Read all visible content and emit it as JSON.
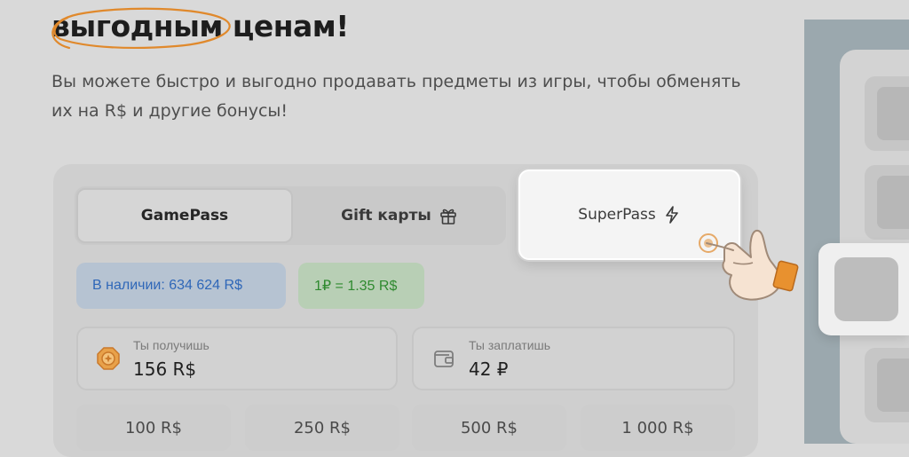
{
  "headline": {
    "highlight": "выгодным",
    "rest": " ценам!"
  },
  "subtitle": "Вы можете быстро и выгодно продавать предметы из игры, чтобы обменять их на R$ и другие бонусы!",
  "tabs": [
    {
      "label": "GamePass"
    },
    {
      "label": "Gift карты",
      "icon": "gift-icon"
    },
    {
      "label": "SuperPass",
      "icon": "lightning-icon",
      "selected": true
    }
  ],
  "badges": {
    "stock": "В наличии: 634 624 R$",
    "rate": "1₽ = 1.35 R$"
  },
  "receive": {
    "label": "Ты получишь",
    "value": "156 R$",
    "icon": "coin-icon"
  },
  "pay": {
    "label": "Ты заплатишь",
    "value": "42 ₽",
    "icon": "wallet-icon"
  },
  "presets": [
    "100 R$",
    "250 R$",
    "500 R$",
    "1 000 R$"
  ],
  "colors": {
    "accent": "#e0892c",
    "stock_text": "#2f67b8",
    "rate_text": "#2f8a2f",
    "side_panel": "#9ba8ae"
  }
}
